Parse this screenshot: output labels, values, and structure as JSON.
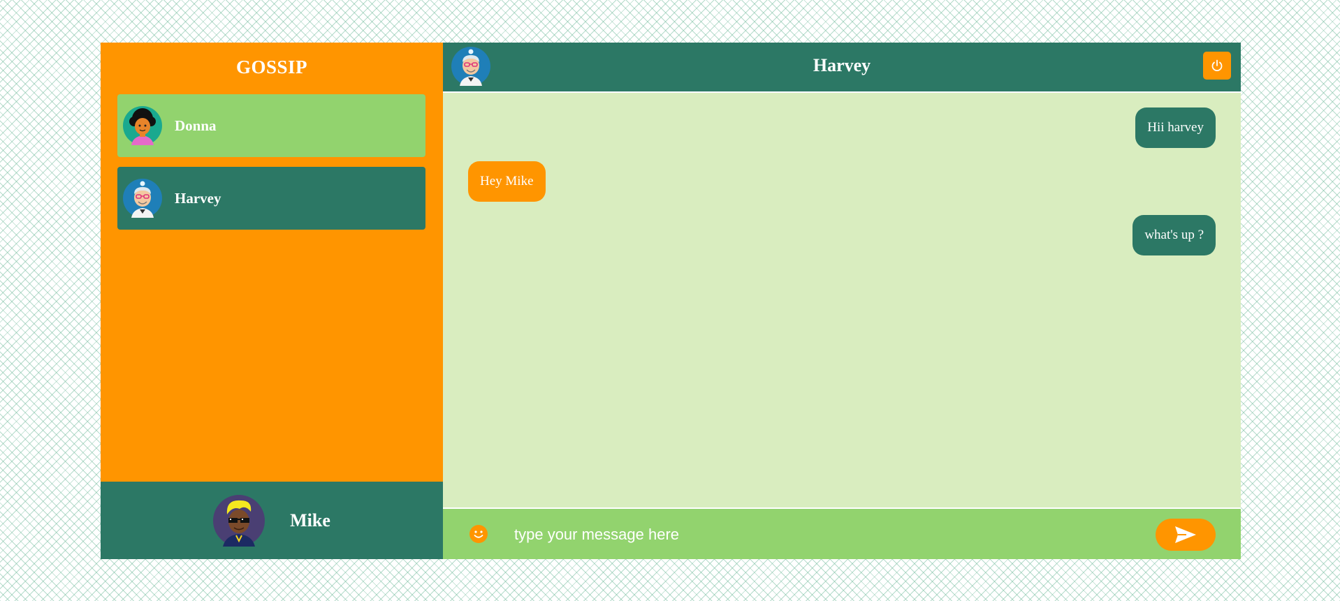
{
  "sidebar": {
    "brand": "GOSSIP",
    "contacts": [
      {
        "name": "Donna",
        "avatar_icon": "donna-avatar-icon",
        "bg": "#92d36e"
      },
      {
        "name": "Harvey",
        "avatar_icon": "harvey-avatar-icon",
        "bg": "#2c7865"
      }
    ],
    "current_user": {
      "name": "Mike",
      "avatar_icon": "mike-avatar-icon"
    }
  },
  "chat": {
    "title": "Harvey",
    "avatar_icon": "harvey-avatar-icon",
    "power_icon": "power-icon",
    "messages": [
      {
        "text": "Hii harvey",
        "direction": "sent"
      },
      {
        "text": "Hey Mike",
        "direction": "received"
      },
      {
        "text": "what's up ?",
        "direction": "sent"
      }
    ]
  },
  "composer": {
    "placeholder": "type your message here",
    "value": "",
    "emoji_icon": "smiley-icon",
    "send_icon": "send-icon"
  },
  "colors": {
    "orange": "#ff9500",
    "teal": "#2c7865",
    "light_green": "#92d36e",
    "chat_bg": "#d9edbf"
  }
}
